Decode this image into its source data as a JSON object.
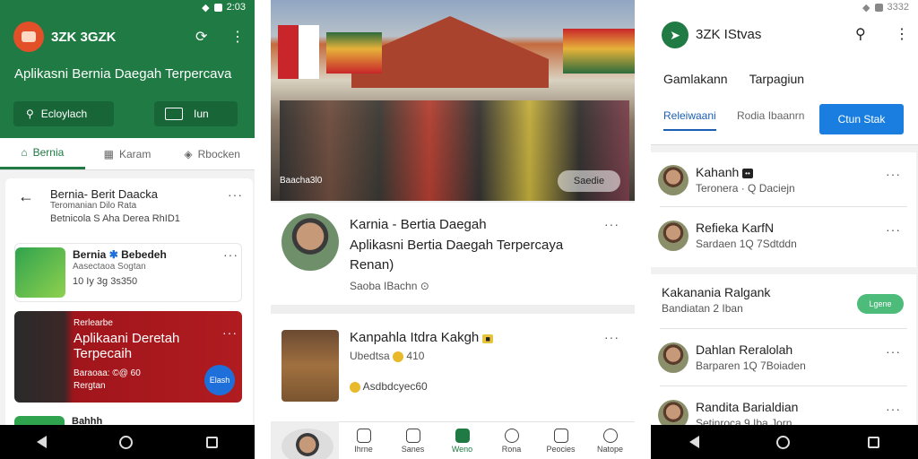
{
  "colors": {
    "brand_green": "#1f7a43",
    "accent_blue": "#1a7ee0",
    "banner_red": "#b01c20"
  },
  "screen1": {
    "status_time": "2:03",
    "app_title": "3ZK 3GZK",
    "tagline": "Aplikasni Bernia Daegah Terpercava",
    "search_label": "Ecloylach",
    "filter_label": "Iun",
    "tabs": [
      {
        "label": "Bernia",
        "icon": "home-icon"
      },
      {
        "label": "Karam",
        "icon": "document-icon"
      },
      {
        "label": "Rbocken",
        "icon": "tag-icon"
      }
    ],
    "detail": {
      "title": "Bernia- Berit Daacka",
      "subtitle": "Teromanian Dilo Rata",
      "meta": "Betnicola S Aha Derea RhID1"
    },
    "card1": {
      "title": "Bernia",
      "title2": "Bebedeh",
      "subtitle": "Aasectaoa Sogtan",
      "meta": "10 Iy 3g 3s350"
    },
    "card2": {
      "kicker": "Rerlearbe",
      "title": "Aplikaani Deretah Terpecaih",
      "meta": "Baraoaa: ©@ 60",
      "meta2": "Rergtan",
      "fab_label": "Elash"
    },
    "card3_title": "Bahhh"
  },
  "screen2": {
    "hero_caption": "Baacha3l0",
    "hero_button": "Saedie",
    "card1": {
      "title": "Karnia - Bertia Daegah",
      "subtitle": "Aplikasni Bertia Daegah Terpercaya",
      "subtitle2": "Renan)",
      "meta": "Saoba IBachn"
    },
    "card2": {
      "title": "Kanpahla Itdra Kakgh",
      "meta": "Ubedtsa",
      "meta_count": "410",
      "tag": "Asdbdcyec60"
    },
    "bottom_nav": [
      {
        "label": "Ihrne",
        "icon": "home-icon"
      },
      {
        "label": "Sanes",
        "icon": "scissors-icon"
      },
      {
        "label": "Weno",
        "icon": "news-icon"
      },
      {
        "label": "Rona",
        "icon": "clock-icon"
      },
      {
        "label": "Peocies",
        "icon": "hand-icon"
      },
      {
        "label": "Natope",
        "icon": "profile-icon"
      }
    ]
  },
  "screen3": {
    "status_time": "3332",
    "app_title": "3ZK IStvas",
    "subnav": [
      "Gamlakann",
      "Tarpagiun"
    ],
    "filter_tabs": [
      "Releiwaani",
      "Rodia Ibaanrn"
    ],
    "cta_label": "Ctun Stak",
    "group1": [
      {
        "name": "Kahanh",
        "badge": "••",
        "meta": "Teronera · Q Daciejn"
      },
      {
        "name": "Refieka KarfN",
        "meta": "Sardaen 1Q 7Sdtddn"
      }
    ],
    "group2": {
      "header": "Kakanania Ralgank",
      "header_meta": "Bandiatan 2 Iban",
      "pill": "Lgene",
      "rows": [
        {
          "name": "Dahlan Reralolah",
          "meta": "Barparen 1Q 7Boiaden"
        },
        {
          "name": "Randita Barialdian",
          "meta": "Setinroca 9 Iba Jorn"
        }
      ]
    }
  }
}
